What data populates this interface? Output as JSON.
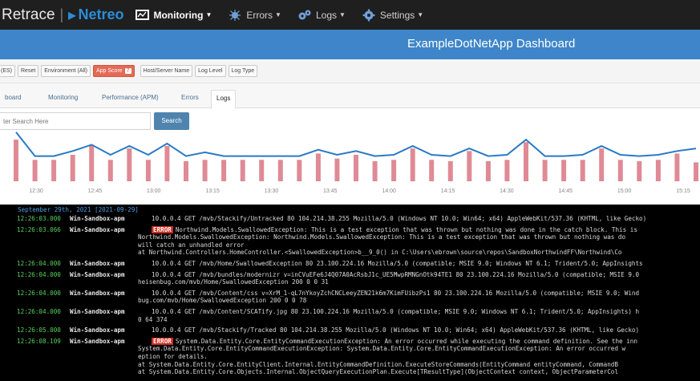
{
  "nav": {
    "brand": "Retrace",
    "separator": "|",
    "partner": "Netreo",
    "items": [
      {
        "label": "Monitoring",
        "icon": "monitor-icon",
        "active": true
      },
      {
        "label": "Errors",
        "icon": "bug-icon",
        "active": false
      },
      {
        "label": "Logs",
        "icon": "gears-icon",
        "active": false
      },
      {
        "label": "Settings",
        "icon": "gear-icon",
        "active": false
      }
    ]
  },
  "header": {
    "title": "ExampleDotNetApp Dashboard"
  },
  "filters": {
    "items": [
      "(ES)",
      "Reset",
      "Environment (All)"
    ],
    "app_score_label": "App Score",
    "app_score_count": "7",
    "right_items": [
      "Host/Server Name",
      "Log Level",
      "Log Type"
    ]
  },
  "tabs": [
    {
      "label": "board"
    },
    {
      "label": "Monitoring"
    },
    {
      "label": "Performance (APM)"
    },
    {
      "label": "Errors"
    },
    {
      "label": "Logs"
    }
  ],
  "search": {
    "placeholder": "ter Search Here",
    "button_label": "Search"
  },
  "colors": {
    "line": "#2a7ac4",
    "bars": "#df8a95",
    "error_badge": "#cc2a1d",
    "timestamp": "#57d35c",
    "date_header": "#4c9be0"
  },
  "chart_data": {
    "type": "bar",
    "x_ticks": [
      "12:30",
      "12:45",
      "13:00",
      "13:15",
      "13:30",
      "13:45",
      "14:00",
      "14:15",
      "14:30",
      "14:45",
      "15:00",
      "15:15"
    ],
    "bars": [
      3.3,
      1.7,
      1.7,
      2.1,
      2.9,
      1.7,
      2.6,
      1.7,
      2.8,
      1.6,
      1.7,
      1.7,
      1.7,
      1.7,
      1.7,
      1.7,
      2.2,
      1.8,
      2.1,
      1.6,
      1.7,
      2.6,
      1.7,
      1.6,
      2.4,
      1.6,
      1.7,
      3.1,
      1.7,
      1.7,
      1.7,
      2.6,
      1.7,
      1.6,
      1.7,
      2.2,
      1.5
    ],
    "line": [
      3.9,
      2.0,
      2.0,
      2.4,
      2.9,
      2.1,
      2.8,
      2.1,
      3.0,
      2.0,
      2.3,
      2.0,
      2.0,
      2.0,
      2.0,
      2.0,
      2.5,
      2.1,
      2.4,
      2.0,
      2.1,
      2.8,
      2.1,
      2.0,
      2.6,
      2.0,
      2.1,
      3.3,
      2.0,
      2.0,
      2.1,
      2.8,
      2.1,
      2.0,
      2.1,
      2.4,
      2.6
    ]
  },
  "log": {
    "date_header": "September 29th, 2021 [2021-09-29]",
    "error_label": "ERROR",
    "entries": [
      {
        "time": "12:26:03.000",
        "host": "Win-Sandbox-apm",
        "error": false,
        "text": "10.0.0.4 GET /mvb/Stackify/Untracked 80 104.214.38.255 Mozilla/5.0 (Windows NT 10.0; Win64; x64) AppleWebKit/537.36 (KHTML, like Gecko)",
        "cont": []
      },
      {
        "time": "12:26:03.066",
        "host": "Win-Sandbox-apm",
        "error": true,
        "text": "Northwind.Models.SwallowedException: This is a test exception that was thrown but nothing was done in the catch block. This is",
        "cont": [
          "Northwind.Models.SwallowedException: Northwind.Models.SwallowedException: This is a test exception that was thrown but nothing was do",
          "will catch an unhandled error",
          "   at Northwind.Controllers.HomeController.<SwallowedException>b__9_0() in C:\\Users\\ebrown\\source\\repos\\SandboxNorthwindFF\\Northwind\\Co"
        ]
      },
      {
        "time": "12:26:04.000",
        "host": "Win-Sandbox-apm",
        "error": false,
        "text": "10.0.0.4 GET /mvb/Home/SwallowedException 80 23.100.224.16 Mozilla/5.0 (compatible; MSIE 9.0; Windows NT 6.1; Trident/5.0; AppInsights",
        "cont": []
      },
      {
        "time": "12:26:04.000",
        "host": "Win-Sandbox-apm",
        "error": false,
        "text": "10.0.0.4 GET /mvb/bundles/modernizr v=inCVuEFe6J4Q07A0AcRsbJ1c_UE5MwpRMNGnOtk94TE1 80 23.100.224.16 Mozilla/5.0 (compatible; MSIE 9.0",
        "cont": [
          "heisenbug.com/mvb/Home/SwallowedException 200 0 0 31"
        ]
      },
      {
        "time": "12:26:04.000",
        "host": "Win-Sandbox-apm",
        "error": false,
        "text": "10.0.0.4 GET /mvb/Content/css v=XrM_1-qL7nYkoyZchCNCLeeyZEN21k6m7KimFUibzPs1 80 23.100.224.16 Mozilla/5.0 (compatible; MSIE 9.0; Wind",
        "cont": [
          "bug.com/mvb/Home/SwallowedException 200 0 0 78"
        ]
      },
      {
        "time": "12:26:04.000",
        "host": "Win-Sandbox-apm",
        "error": false,
        "text": "10.0.0.4 GET /mvb/Content/SCATify.jpg 80 23.100.224.16 Mozilla/5.0 (compatible; MSIE 9.0; Windows NT 6.1; Trident/5.0; AppInsights) h",
        "cont": [
          "0 64 374"
        ]
      },
      {
        "time": "12:26:05.000",
        "host": "Win-Sandbox-apm",
        "error": false,
        "text": "10.0.0.4 GET /mvb/Stackify/Tracked 80 104.214.38.255 Mozilla/5.0 (Windows NT 10.0; Win64; x64) AppleWebKit/537.36 (KHTML, like Gecko)",
        "cont": []
      },
      {
        "time": "12:26:08.109",
        "host": "Win-Sandbox-apm",
        "error": true,
        "text": "System.Data.Entity.Core.EntityCommandExecutionException: An error occurred while executing the command definition. See the inn",
        "cont": [
          "System.Data.Entity.Core.EntityCommandExecutionException: System.Data.Entity.Core.EntityCommandExecutionException: An error occurred w",
          "eption for details.",
          "   at System.Data.Entity.Core.EntityClient.Internal.EntityCommandDefinition.ExecuteStoreCommands(EntityCommand entityCommand, CommandB",
          "   at System.Data.Entity.Core.Objects.Internal.ObjectQueryExecutionPlan.Execute[TResultType](ObjectContext context, ObjectParameterCol"
        ]
      }
    ]
  }
}
